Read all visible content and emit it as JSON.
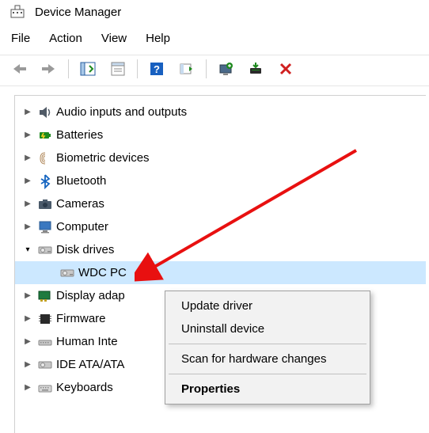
{
  "window": {
    "title": "Device Manager"
  },
  "menu": {
    "file": "File",
    "action": "Action",
    "view": "View",
    "help": "Help"
  },
  "tree": {
    "audio": "Audio inputs and outputs",
    "batteries": "Batteries",
    "biometric": "Biometric devices",
    "bluetooth": "Bluetooth",
    "cameras": "Cameras",
    "computer": "Computer",
    "diskdrives": "Disk drives",
    "disk_child": "WDC PC",
    "display": "Display adap",
    "firmware": "Firmware",
    "hid": "Human Inte",
    "ide": "IDE ATA/ATA",
    "keyboards": "Keyboards"
  },
  "context": {
    "update": "Update driver",
    "uninstall": "Uninstall device",
    "scan": "Scan for hardware changes",
    "properties": "Properties"
  }
}
